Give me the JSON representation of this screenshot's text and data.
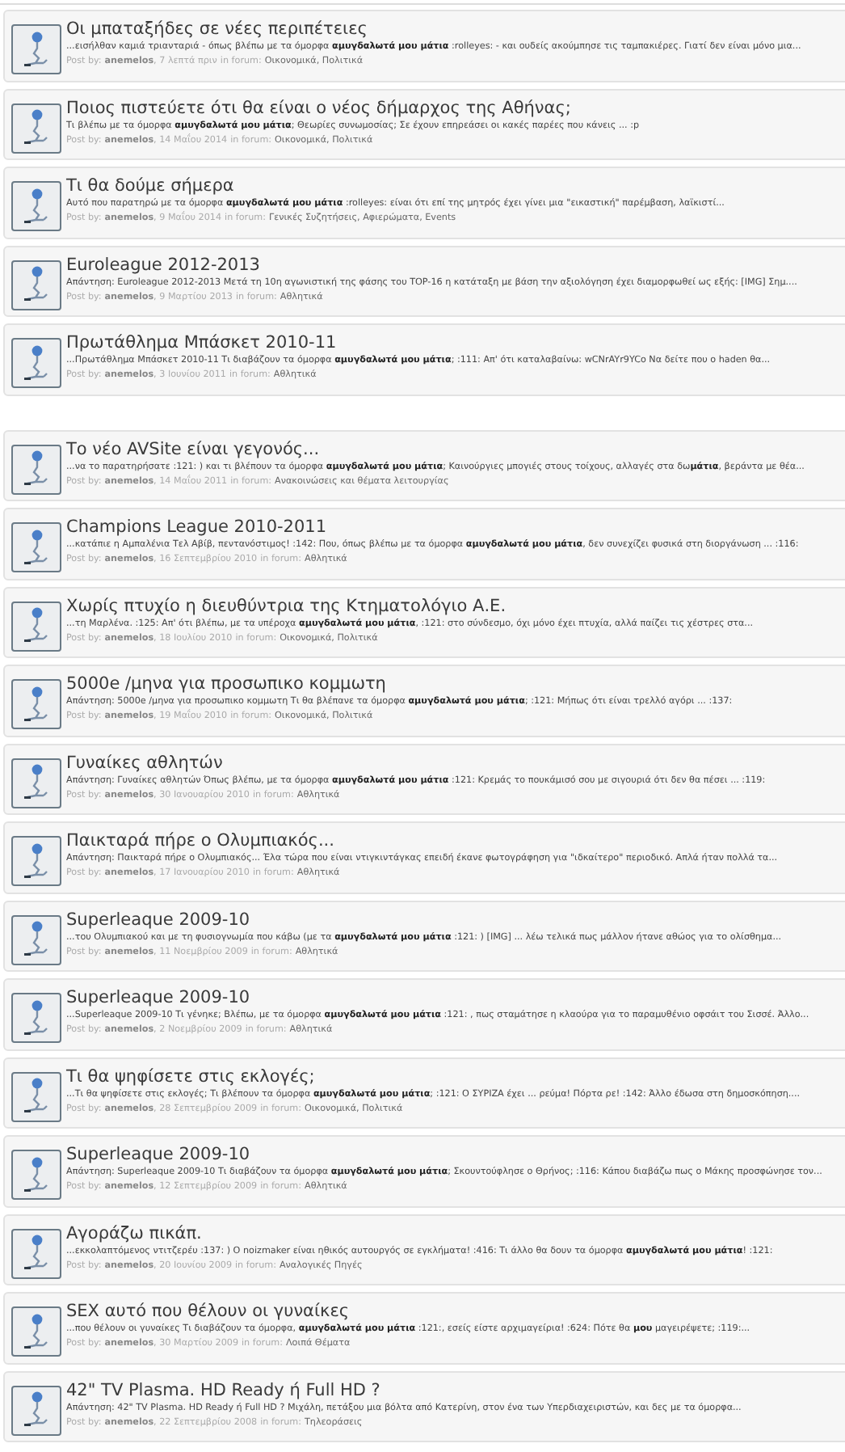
{
  "result_groups": [
    {
      "items": [
        {
          "title": "Οι μπαταξήδες σε νέες περιπέτειες",
          "snippet": "...εισήλθαν καμιά τριανταριά - όπως βλέπω με τα όμορφα **αμυγδαλωτά μου μάτια** :rolleyes: - και ουδείς ακούμπησε τις ταμπακιέρες. Γιατί δεν είναι μόνο μια...",
          "by_label": "Post by:",
          "author": "anemelos",
          "date": ", 7 λεπτά πριν",
          "forum_label": "in forum:",
          "forum": "Οικονομικά, Πολιτικά"
        },
        {
          "title": "Ποιος πιστεύετε ότι θα είναι ο νέος δήμαρχος της Αθήνας;",
          "snippet": "Τι βλέπω με τα όμορφα **αμυγδαλωτά μου μάτια**; Θεωρίες συνωμοσίας; Σε έχουν επηρεάσει οι κακές παρέες που κάνεις ... :p",
          "by_label": "Post by:",
          "author": "anemelos",
          "date": ", 14 Μαΐου 2014",
          "forum_label": "in forum:",
          "forum": "Οικονομικά, Πολιτικά"
        },
        {
          "title": "Τι θα δούμε σήμερα",
          "snippet": "Αυτό που παρατηρώ με τα όμορφα **αμυγδαλωτά μου μάτια** :rolleyes: είναι ότι επί της μητρός έχει γίνει μια \"εικαστική\" παρέμβαση, λαϊκιστί...",
          "by_label": "Post by:",
          "author": "anemelos",
          "date": ", 9 Μαΐου 2014",
          "forum_label": "in forum:",
          "forum": "Γενικές Συζητήσεις, Αφιερώματα, Events"
        },
        {
          "title": "Euroleague 2012-2013",
          "snippet": "Απάντηση: Euroleague 2012-2013 Μετά τη 10η αγωνιστική της φάσης του TOP-16 η κατάταξη με βάση την αξιολόγηση έχει διαμορφωθεί ως εξής: [IMG] Σημ....",
          "by_label": "Post by:",
          "author": "anemelos",
          "date": ", 9 Μαρτίου 2013",
          "forum_label": "in forum:",
          "forum": "Αθλητικά"
        },
        {
          "title": "Πρωτάθλημα Μπάσκετ 2010-11",
          "snippet": "...Πρωτάθλημα Μπάσκετ 2010-11 Τι διαβάζουν τα όμορφα **αμυγδαλωτά μου μάτια**; :111: Απ' ότι καταλαβαίνω: wCNrAYr9YCo Να δείτε που ο haden θα...",
          "by_label": "Post by:",
          "author": "anemelos",
          "date": ", 3 Ιουνίου 2011",
          "forum_label": "in forum:",
          "forum": "Αθλητικά"
        }
      ]
    },
    {
      "items": [
        {
          "title": "Το νέο AVSite είναι γεγονός...",
          "snippet": "...να το παρατηρήσατε :121: ) και τι βλέπουν τα όμορφα **αμυγδαλωτά μου μάτια**; Καινούργιες μπογιές στους τοίχους, αλλαγές στα δω**μάτια**, βεράντα με θέα...",
          "by_label": "Post by:",
          "author": "anemelos",
          "date": ", 14 Μαΐου 2011",
          "forum_label": "in forum:",
          "forum": "Ανακοινώσεις και θέματα λειτουργίας"
        },
        {
          "title": "Champions League 2010-2011",
          "snippet": "...κατάπιε η Αμπαλένια Τελ Αβίβ, πεντανόστιμος! :142: Που, όπως βλέπω με τα όμορφα **αμυγδαλωτά μου μάτια**, δεν συνεχίζει φυσικά στη διοργάνωση ... :116:",
          "by_label": "Post by:",
          "author": "anemelos",
          "date": ", 16 Σεπτεμβρίου 2010",
          "forum_label": "in forum:",
          "forum": "Αθλητικά"
        },
        {
          "title": "Χωρίς πτυχίο η διευθύντρια της Κτηματολόγιο Α.Ε.",
          "snippet": "...τη Μαρλένα. :125: Απ' ότι βλέπω, με τα υπέροχα **αμυγδαλωτά μου μάτια**, :121: στο σύνδεσμο, όχι μόνο έχει πτυχία, αλλά παίζει τις χέστρες στα...",
          "by_label": "Post by:",
          "author": "anemelos",
          "date": ", 18 Ιουλίου 2010",
          "forum_label": "in forum:",
          "forum": "Οικονομικά, Πολιτικά"
        },
        {
          "title": "5000e /μηνα για προσωπικο κομμωτη",
          "snippet": "Απάντηση: 5000e /μηνα για προσωπικο κομμωτη Τι θα βλέπανε τα όμορφα **αμυγδαλωτά μου μάτια**; :121: Μήπως ότι είναι τρελλό αγόρι ... :137:",
          "by_label": "Post by:",
          "author": "anemelos",
          "date": ", 19 Μαΐου 2010",
          "forum_label": "in forum:",
          "forum": "Οικονομικά, Πολιτικά"
        },
        {
          "title": "Γυναίκες αθλητών",
          "snippet": "Απάντηση: Γυναίκες αθλητών Όπως βλέπω, με τα όμορφα **αμυγδαλωτά μου μάτια** :121: Κρεμάς το πουκάμισό σου με σιγουριά ότι δεν θα πέσει ... :119:",
          "by_label": "Post by:",
          "author": "anemelos",
          "date": ", 30 Ιανουαρίου 2010",
          "forum_label": "in forum:",
          "forum": "Αθλητικά"
        },
        {
          "title": "Παικταρά πήρε ο Ολυμπιακός...",
          "snippet": "Απάντηση: Παικταρά πήρε ο Ολυμπιακός... Έλα τώρα που είναι ντιγκιντάγκας επειδή έκανε φωτογράφηση για \"ιδκαίτερο\" περιοδικό. Απλά ήταν πολλά τα...",
          "by_label": "Post by:",
          "author": "anemelos",
          "date": ", 17 Ιανουαρίου 2010",
          "forum_label": "in forum:",
          "forum": "Αθλητικά"
        },
        {
          "title": "Superleaque 2009-10",
          "snippet": "...του Ολυμπιακού και με τη φυσιογνωμία που κάβω (με τα **αμυγδαλωτά μου μάτια** :121: ) [IMG] ... λέω τελικά πως μάλλον ήτανε αθώος για το ολίσθημα...",
          "by_label": "Post by:",
          "author": "anemelos",
          "date": ", 11 Νοεμβρίου 2009",
          "forum_label": "in forum:",
          "forum": "Αθλητικά"
        },
        {
          "title": "Superleaque 2009-10",
          "snippet": "...Superleaque 2009-10 Τι γένηκε; Βλέπω, με τα όμορφα **αμυγδαλωτά μου μάτια** :121: , πως σταμάτησε η κλαούρα για το παραμυθένιο οφσάιτ του Σισσέ. Άλλο...",
          "by_label": "Post by:",
          "author": "anemelos",
          "date": ", 2 Νοεμβρίου 2009",
          "forum_label": "in forum:",
          "forum": "Αθλητικά"
        },
        {
          "title": "Τι θα ψηφίσετε στις εκλογές;",
          "snippet": "...Τι θα ψηφίσετε στις εκλογές; Τι βλέπουν τα όμορφα **αμυγδαλωτά μου μάτια**; :121: Ο ΣΥΡΙΖΑ έχει ... ρεύμα! Πόρτα ρε! :142: Άλλο έδωσα στη δημοσκόπηση....",
          "by_label": "Post by:",
          "author": "anemelos",
          "date": ", 28 Σεπτεμβρίου 2009",
          "forum_label": "in forum:",
          "forum": "Οικονομικά, Πολιτικά"
        },
        {
          "title": "Superleaque 2009-10",
          "snippet": "Απάντηση: Superleaque 2009-10 Τι διαβάζουν τα όμορφα **αμυγδαλωτά μου μάτια**; Σκουντούφλησε ο Θρήνος; :116: Κάπου διαβάζω πως ο Μάκης προσφώνησε τον...",
          "by_label": "Post by:",
          "author": "anemelos",
          "date": ", 12 Σεπτεμβρίου 2009",
          "forum_label": "in forum:",
          "forum": "Αθλητικά"
        },
        {
          "title": "Αγοράζω πικάπ.",
          "snippet": "...εκκολαπτόμενος ντιτζερέυ :137: ) Ο noizmaker είναι ηθικός αυτουργός σε εγκλήματα! :416: Τι άλλο θα δουν τα όμορφα **αμυγδαλωτά μου μάτια**! :121:",
          "by_label": "Post by:",
          "author": "anemelos",
          "date": ", 20 Ιουνίου 2009",
          "forum_label": "in forum:",
          "forum": "Αναλογικές Πηγές"
        },
        {
          "title": "SEX αυτό που θέλουν οι γυναίκες",
          "snippet": "...που θέλουν οι γυναίκες Τι διαβάζουν τα όμορφα, **αμυγδαλωτά μου μάτια** :121:, εσείς είστε αρχιμαγείρια! :624: Πότε θα **μου** μαγειρέψετε; :119:...",
          "by_label": "Post by:",
          "author": "anemelos",
          "date": ", 30 Μαρτίου 2009",
          "forum_label": "in forum:",
          "forum": "Λοιπά Θέματα"
        },
        {
          "title": "42\" TV Plasma. HD Ready ή Full HD ?",
          "snippet": "Απάντηση: 42\" TV Plasma. HD Ready ή Full HD ? Μιχάλη, πετάξου μια βόλτα από Κατερίνη, στον ένα των Υπερδιαχειριστών, και δες με τα όμορφα...",
          "by_label": "Post by:",
          "author": "anemelos",
          "date": ", 22 Σεπτεμβρίου 2008",
          "forum_label": "in forum:",
          "forum": "Τηλεοράσεις"
        }
      ]
    }
  ]
}
